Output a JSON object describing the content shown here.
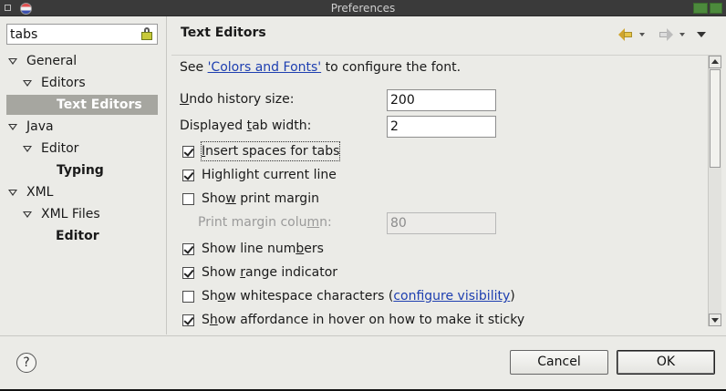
{
  "window": {
    "title": "Preferences"
  },
  "filter": {
    "value": "tabs"
  },
  "tree": [
    {
      "label": "General"
    },
    {
      "label": "Editors"
    },
    {
      "label": "Text Editors"
    },
    {
      "label": "Java"
    },
    {
      "label": "Editor"
    },
    {
      "label": "Typing"
    },
    {
      "label": "XML"
    },
    {
      "label": "XML Files"
    },
    {
      "label": "Editor"
    }
  ],
  "page": {
    "title": "Text Editors",
    "see_prefix": "See ",
    "see_link": "'Colors and Fonts'",
    "see_suffix": " to configure the font.",
    "undo_label_u": "U",
    "undo_label_rest": "ndo history size:",
    "undo_value": "200",
    "tab_label_pre": "Displayed ",
    "tab_label_u": "t",
    "tab_label_rest": "ab width:",
    "tab_value": "2",
    "print_col_pre": "Print margin colu",
    "print_col_u": "m",
    "print_col_rest": "n:",
    "print_col_value": "80",
    "checkboxes": [
      {
        "pre": "",
        "u": "I",
        "rest": "nsert spaces for tabs",
        "checked": true
      },
      {
        "pre": "",
        "u": "",
        "rest": "Highlight current line",
        "checked": true
      },
      {
        "pre": "Sho",
        "u": "w",
        "rest": " print margin",
        "checked": false
      },
      {
        "pre": "Show line num",
        "u": "b",
        "rest": "ers",
        "checked": true
      },
      {
        "pre": "Show ",
        "u": "r",
        "rest": "ange indicator",
        "checked": true
      },
      {
        "pre": "Sh",
        "u": "o",
        "rest": "w whitespace characters (",
        "link": "configure visibility",
        "tail": ")",
        "checked": false
      },
      {
        "pre": "S",
        "u": "h",
        "rest": "ow affordance in hover on how to make it sticky",
        "checked": true
      }
    ]
  },
  "buttons": {
    "help": "?",
    "cancel": "Cancel",
    "ok": "OK"
  }
}
